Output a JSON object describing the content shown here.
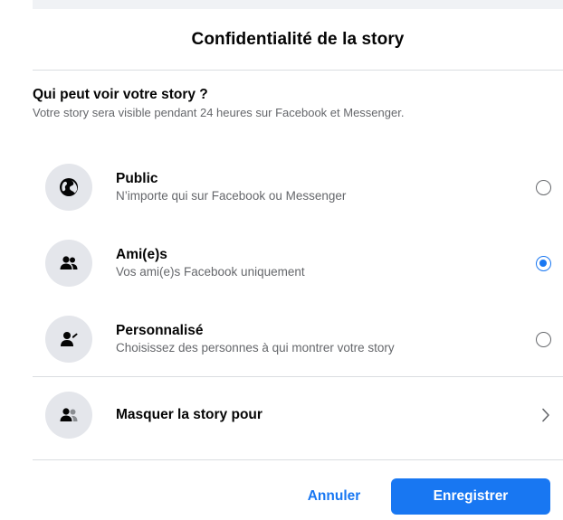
{
  "dialog": {
    "title": "Confidentialité de la story"
  },
  "audience": {
    "heading": "Qui peut voir votre story ?",
    "subheading": "Votre story sera visible pendant 24 heures sur Facebook et Messenger.",
    "options": [
      {
        "title": "Public",
        "description": "N’importe qui sur Facebook ou Messenger",
        "icon": "globe-icon",
        "selected": false
      },
      {
        "title": "Ami(e)s",
        "description": "Vos ami(e)s Facebook uniquement",
        "icon": "friends-icon",
        "selected": true
      },
      {
        "title": "Personnalisé",
        "description": "Choisissez des personnes à qui montrer votre story",
        "icon": "custom-person-icon",
        "selected": false
      }
    ]
  },
  "hide_story": {
    "label": "Masquer la story pour",
    "icon": "hide-people-icon"
  },
  "footer": {
    "cancel_label": "Annuler",
    "save_label": "Enregistrer"
  },
  "colors": {
    "accent": "#1877f2",
    "icon_bg": "#e4e6eb",
    "secondary_text": "#65676b",
    "divider": "#dadde1"
  }
}
